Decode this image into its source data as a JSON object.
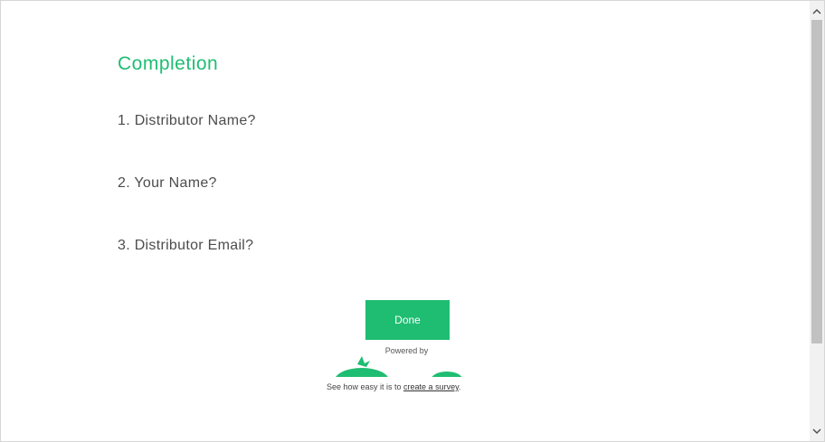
{
  "page": {
    "title": "Completion",
    "questions": [
      "1. Distributor Name?",
      "2. Your Name?",
      "3. Distributor Email?"
    ],
    "done_label": "Done",
    "powered_by": "Powered by",
    "footer_prefix": "See how easy it is to ",
    "footer_link": "create a survey",
    "footer_suffix": "."
  },
  "colors": {
    "accent": "#1fbd72",
    "text": "#4d4d4d"
  },
  "icons": {
    "logo": "surveymonkey-logo",
    "scroll_up": "chevron-up-icon",
    "scroll_down": "chevron-down-icon"
  }
}
